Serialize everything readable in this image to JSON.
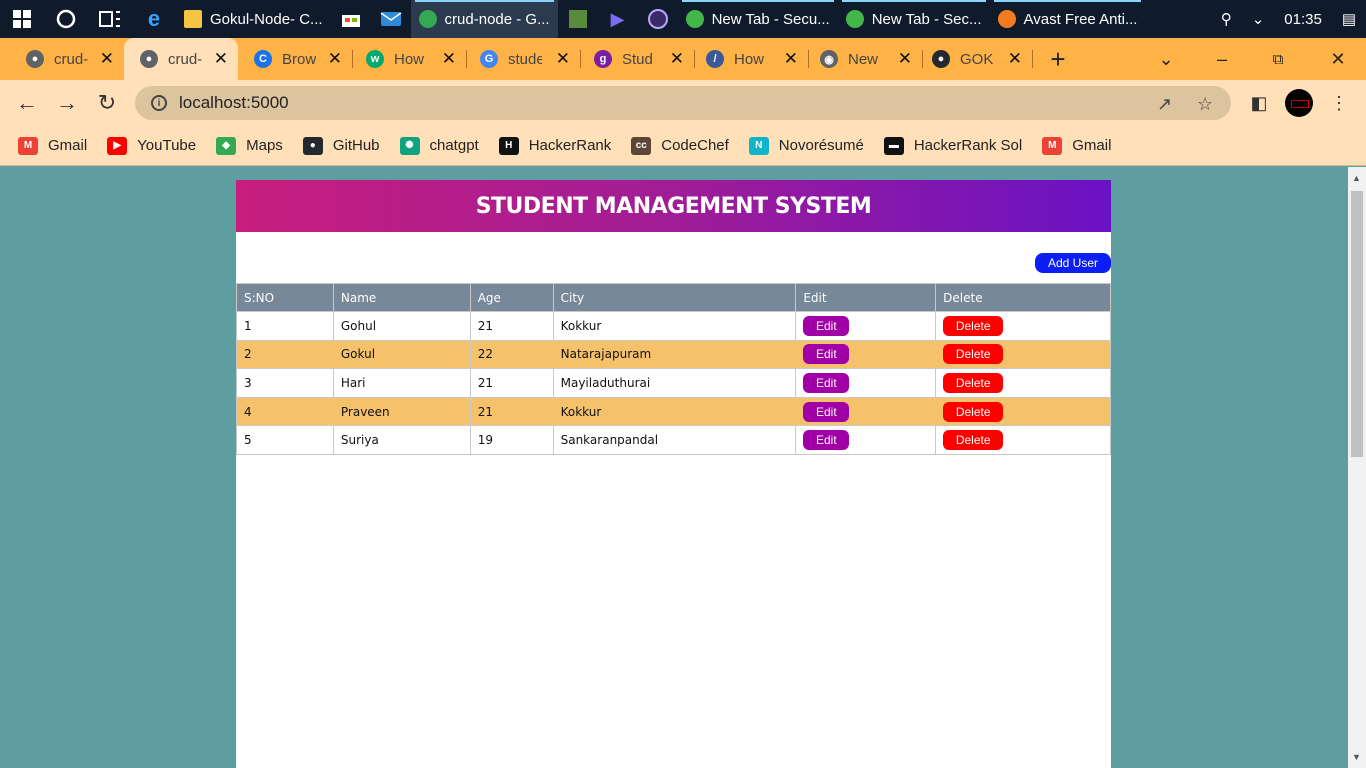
{
  "taskbar": {
    "apps": [
      {
        "label": "Gokul-Node- C...",
        "color": "#f5c542",
        "active": false
      },
      {
        "label": "crud-node - G...",
        "color": "#34a853",
        "active": true
      },
      {
        "label": "New Tab - Secu...",
        "color": "#43b649",
        "active": false
      },
      {
        "label": "New Tab - Sec...",
        "color": "#43b649",
        "active": false
      },
      {
        "label": "Avast Free Anti...",
        "color": "#f47b20",
        "active": false
      }
    ],
    "time": "01:35"
  },
  "tabs": [
    {
      "title": "crud-",
      "icon": "globe-icon",
      "color": "#5f6368"
    },
    {
      "title": "crud-",
      "icon": "globe-icon",
      "color": "#5f6368"
    },
    {
      "title": "Brow",
      "icon": "c-icon",
      "color": "#1a73e8"
    },
    {
      "title": "How",
      "icon": "w3-icon",
      "color": "#04aa6d"
    },
    {
      "title": "stude",
      "icon": "google-icon",
      "color": "#4285f4"
    },
    {
      "title": "Stud",
      "icon": "g-icon",
      "color": "#7b1fa2"
    },
    {
      "title": "How",
      "icon": "edge-icon",
      "color": "#3b5998"
    },
    {
      "title": "New",
      "icon": "chrome-icon",
      "color": "#5f6368"
    },
    {
      "title": "GOK",
      "icon": "github-icon",
      "color": "#24292e"
    }
  ],
  "address": {
    "url": "localhost:5000"
  },
  "bookmarks": [
    {
      "label": "Gmail",
      "icon": "gmail-icon",
      "color": "#ea4335",
      "glyph": "M"
    },
    {
      "label": "YouTube",
      "icon": "youtube-icon",
      "color": "#ff0000",
      "glyph": "▶"
    },
    {
      "label": "Maps",
      "icon": "maps-icon",
      "color": "#34a853",
      "glyph": "◆"
    },
    {
      "label": "GitHub",
      "icon": "github-icon",
      "color": "#24292e",
      "glyph": "●"
    },
    {
      "label": "chatgpt",
      "icon": "chatgpt-icon",
      "color": "#10a37f",
      "glyph": "✺"
    },
    {
      "label": "HackerRank",
      "icon": "hackerrank-icon",
      "color": "#111",
      "glyph": "H"
    },
    {
      "label": "CodeChef",
      "icon": "codechef-icon",
      "color": "#5b4638",
      "glyph": "cc"
    },
    {
      "label": "Novorésumé",
      "icon": "novoresume-icon",
      "color": "#11b5c9",
      "glyph": "N"
    },
    {
      "label": "HackerRank Sol",
      "icon": "hackerrank-sol-icon",
      "color": "#111",
      "glyph": "▬"
    },
    {
      "label": "Gmail",
      "icon": "gmail-icon",
      "color": "#ea4335",
      "glyph": "M"
    }
  ],
  "page": {
    "title": "STUDENT MANAGEMENT SYSTEM",
    "add_user_label": "Add User",
    "columns": [
      "S:NO",
      "Name",
      "Age",
      "City",
      "Edit",
      "Delete"
    ],
    "edit_label": "Edit",
    "delete_label": "Delete",
    "rows": [
      {
        "sno": "1",
        "name": "Gohul",
        "age": "21",
        "city": "Kokkur"
      },
      {
        "sno": "2",
        "name": "Gokul",
        "age": "22",
        "city": "Natarajapuram"
      },
      {
        "sno": "3",
        "name": "Hari",
        "age": "21",
        "city": "Mayiladuthurai"
      },
      {
        "sno": "4",
        "name": "Praveen",
        "age": "21",
        "city": "Kokkur"
      },
      {
        "sno": "5",
        "name": "Suriya",
        "age": "19",
        "city": "Sankaranpandal"
      }
    ]
  }
}
